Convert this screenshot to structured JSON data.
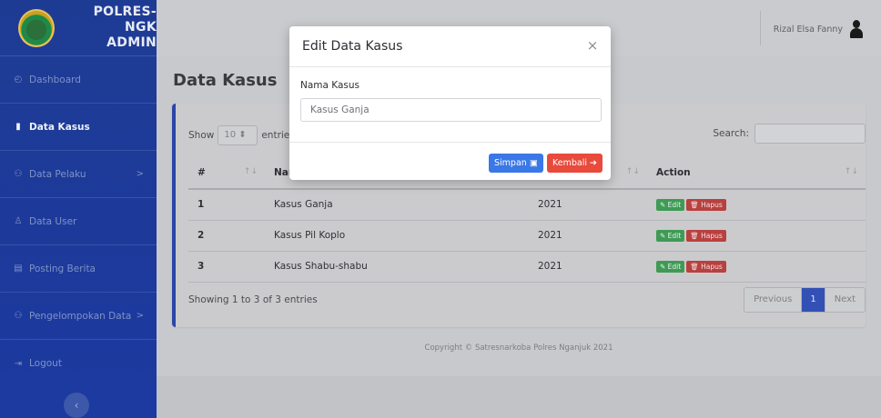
{
  "brand": {
    "line1": "POLRES-NGK",
    "line2": "ADMIN"
  },
  "sidebar": {
    "items": [
      {
        "label": "Dashboard",
        "icon": "dashboard-icon"
      },
      {
        "label": "Data Kasus",
        "icon": "file-icon"
      },
      {
        "label": "Data Pelaku",
        "icon": "users-icon"
      },
      {
        "label": "Data User",
        "icon": "user-icon"
      },
      {
        "label": "Posting Berita",
        "icon": "newspaper-icon"
      },
      {
        "label": "Pengelompokan Data",
        "icon": "users-icon"
      },
      {
        "label": "Logout",
        "icon": "logout-icon"
      }
    ],
    "chevron": ">",
    "toggle": "‹"
  },
  "topbar": {
    "user_name": "Rizal Elsa Fanny"
  },
  "page": {
    "title": "Data Kasus"
  },
  "table": {
    "show_label": "Show",
    "page_size": "10",
    "entries_label": "entries",
    "search_label": "Search:",
    "columns": [
      "#",
      "Nar",
      "",
      "Action"
    ],
    "rows": [
      {
        "no": "1",
        "nama": "Kasus Ganja",
        "tahun": "2021"
      },
      {
        "no": "2",
        "nama": "Kasus Pil Koplo",
        "tahun": "2021"
      },
      {
        "no": "3",
        "nama": "Kasus Shabu-shabu",
        "tahun": "2021"
      }
    ],
    "edit_label": "Edit",
    "hapus_label": "Hapus",
    "info": "Showing 1 to 3 of 3 entries",
    "pager": {
      "prev": "Previous",
      "current": "1",
      "next": "Next"
    }
  },
  "footer": {
    "text": "Copyright © Satresnarkoba Polres Nganjuk 2021"
  },
  "modal": {
    "title": "Edit Data Kasus",
    "close": "×",
    "field_label": "Nama Kasus",
    "field_value": "Kasus Ganja",
    "save_label": "Simpan",
    "back_label": "Kembali"
  },
  "colors": {
    "sidebar": "#1e3b94",
    "accent": "#3350b5",
    "save": "#3b78e7",
    "back": "#e84a3c",
    "edit": "#3f9a55",
    "delete": "#b8403f"
  }
}
